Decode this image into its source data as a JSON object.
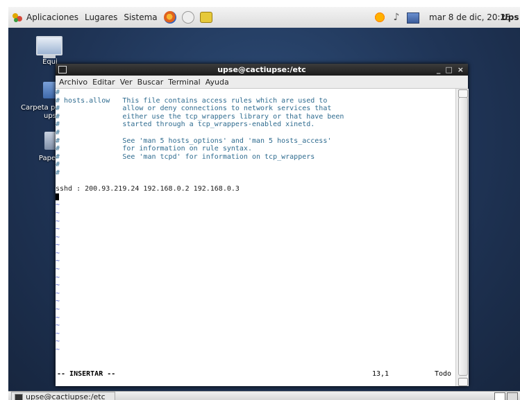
{
  "top_panel": {
    "menus": [
      "Aplicaciones",
      "Lugares",
      "Sistema"
    ],
    "launchers": [
      "firefox-icon",
      "mail-icon",
      "notes-icon"
    ],
    "tray": [
      "updates-icon",
      "volume-icon",
      "network-icon"
    ],
    "clock": "mar 8 de dic, 20:25",
    "user": "Ups"
  },
  "desktop": {
    "icons": [
      {
        "label": "Equi",
        "icon": "computer-icon"
      },
      {
        "label": "Carpeta pe",
        "label2": "ups",
        "icon": "home-folder-icon"
      },
      {
        "label": "Pape",
        "icon": "trash-icon"
      }
    ]
  },
  "window": {
    "title": "upse@cactiupse:/etc",
    "controls": [
      "_",
      "□",
      "×"
    ],
    "menus": [
      "Archivo",
      "Editar",
      "Ver",
      "Buscar",
      "Terminal",
      "Ayuda"
    ],
    "lines": [
      "#",
      "# hosts.allow   This file contains access rules which are used to",
      "#               allow or deny connections to network services that",
      "#               either use the tcp_wrappers library or that have been",
      "#               started through a tcp_wrappers-enabled xinetd.",
      "#",
      "#               See 'man 5 hosts_options' and 'man 5 hosts_access'",
      "#               for information on rule syntax.",
      "#               See 'man tcpd' for information on tcp_wrappers",
      "#",
      "#",
      "sshd : 200.93.219.24 192.168.0.2 192.168.0.3"
    ],
    "tilde": "~",
    "mode": "-- INSERTAR --",
    "position": "13,1",
    "percent": "Todo"
  },
  "bottom_panel": {
    "task": "upse@cactiupse:/etc"
  }
}
